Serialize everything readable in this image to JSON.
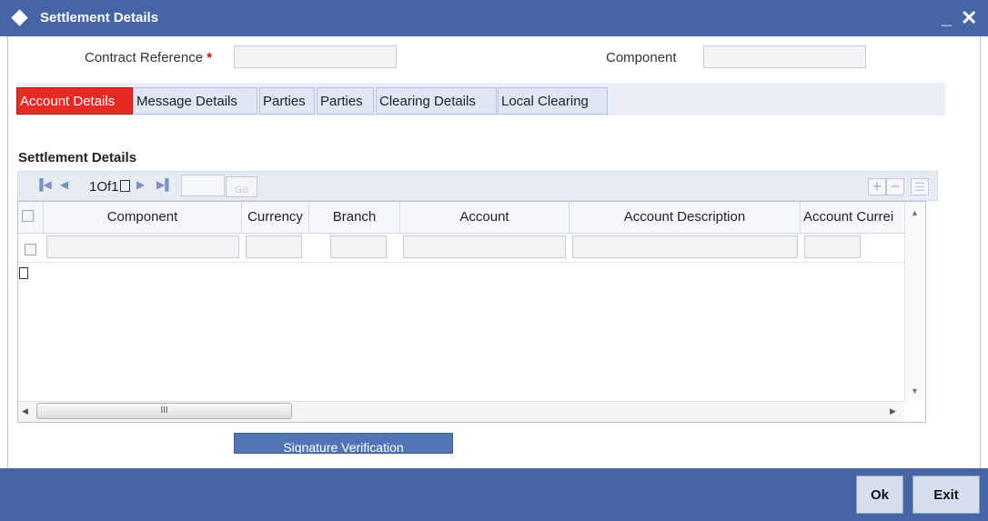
{
  "window": {
    "title": "Settlement Details",
    "minimize_label": "_",
    "close_label": "✕"
  },
  "header": {
    "contract_reference_label": "Contract Reference",
    "required_marker": "*",
    "contract_reference_value": "",
    "component_label": "Component",
    "component_value": ""
  },
  "tabs": [
    {
      "label": "Account Details",
      "active": true
    },
    {
      "label": "Message Details",
      "active": false
    },
    {
      "label": "Parties",
      "active": false
    },
    {
      "label": "Parties",
      "active": false
    },
    {
      "label": "Clearing Details",
      "active": false
    },
    {
      "label": "Local Clearing",
      "active": false
    }
  ],
  "grid": {
    "section_title": "Settlement Details",
    "pager_text": "1Of1",
    "go_label": "Go",
    "columns": [
      "Component",
      "Currency",
      "Branch",
      "Account",
      "Account Description",
      "Account Currei"
    ],
    "rows": [
      {
        "component": "",
        "currency": "",
        "branch": "",
        "account": "",
        "account_description": "",
        "account_currency": ""
      }
    ],
    "scroll_mid": "III"
  },
  "signature_button": "Signature Verification",
  "footer": {
    "ok_label": "Ok",
    "exit_label": "Exit"
  },
  "colors": {
    "title_bar": "#4565a4",
    "active_tab": "#e62a24",
    "footer": "#4565a4"
  }
}
